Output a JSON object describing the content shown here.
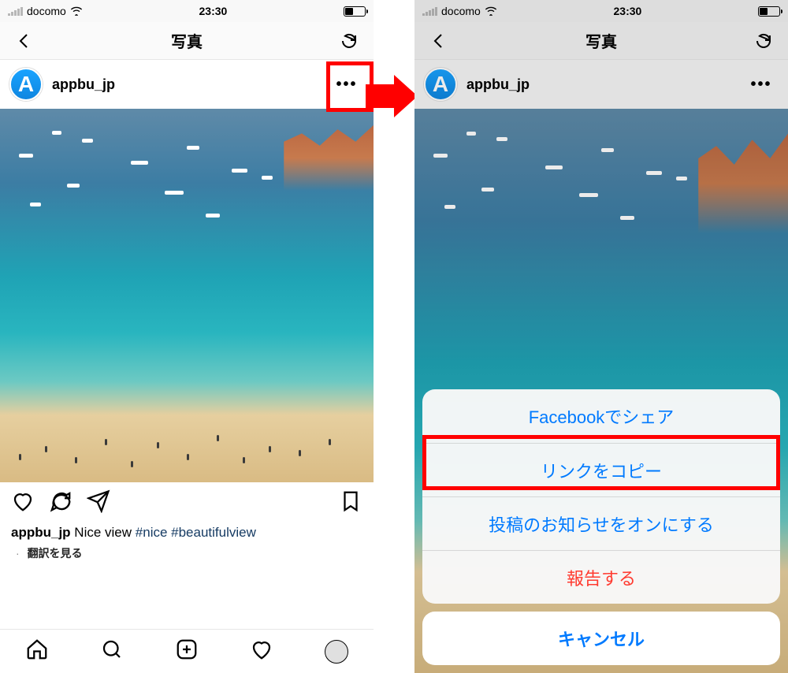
{
  "status": {
    "carrier": "docomo",
    "time": "23:30"
  },
  "nav": {
    "title": "写真"
  },
  "post": {
    "avatar_letter": "A",
    "username": "appbu_jp",
    "caption_user": "appbu_jp",
    "caption_text": "Nice view",
    "caption_tags": "#nice #beautifulview",
    "translate_label": "翻訳を見る"
  },
  "sheet": {
    "items": [
      "Facebookでシェア",
      "リンクをコピー",
      "投稿のお知らせをオンにする",
      "報告する"
    ],
    "cancel": "キャンセル"
  }
}
